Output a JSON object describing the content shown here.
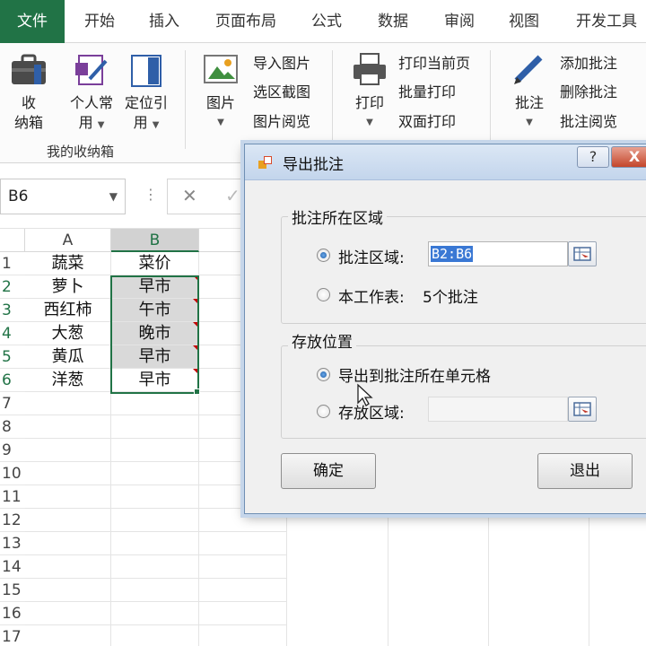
{
  "tabs": [
    "文件",
    "开始",
    "插入",
    "页面布局",
    "公式",
    "数据",
    "审阅",
    "视图",
    "开发工具"
  ],
  "ribbon": {
    "storage": {
      "line1": "收",
      "line2": "纳箱"
    },
    "personal": {
      "line1": "个人常",
      "line2": "用"
    },
    "locate": {
      "line1": "定位引",
      "line2": "用"
    },
    "group_label": "我的收纳箱",
    "picture": {
      "label": "图片"
    },
    "picture_items": [
      "导入图片",
      "选区截图",
      "图片阅览"
    ],
    "print": {
      "label": "打印"
    },
    "print_items": [
      "打印当前页",
      "批量打印",
      "双面打印"
    ],
    "comment": {
      "label": "批注"
    },
    "comment_items": [
      "添加批注",
      "删除批注",
      "批注阅览"
    ]
  },
  "formula_bar": {
    "name_box": "B6"
  },
  "sheet": {
    "columns": [
      "A",
      "B"
    ],
    "rows": [
      "1",
      "2",
      "3",
      "4",
      "5",
      "6",
      "7",
      "8",
      "9",
      "10",
      "11",
      "12",
      "13",
      "14",
      "15",
      "16",
      "17"
    ],
    "data": [
      [
        "蔬菜",
        "菜价"
      ],
      [
        "萝卜",
        "早市"
      ],
      [
        "西红柿",
        "午市"
      ],
      [
        "大葱",
        "晚市"
      ],
      [
        "黄瓜",
        "早市"
      ],
      [
        "洋葱",
        "早市"
      ]
    ]
  },
  "dialog": {
    "title": "导出批注",
    "help": "?",
    "close": "X",
    "group1": "批注所在区域",
    "opt_range": "批注区域:",
    "range_value": "B2:B6",
    "opt_sheet": "本工作表:",
    "sheet_count": "5个批注",
    "group2": "存放位置",
    "opt_export_cell": "导出到批注所在单元格",
    "opt_store": "存放区域:",
    "ok": "确定",
    "exit": "退出"
  }
}
